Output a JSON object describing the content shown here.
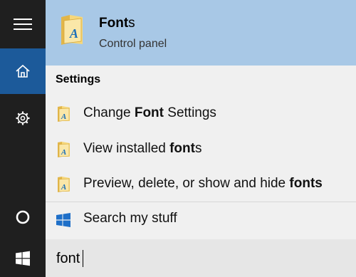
{
  "rail": {
    "icons": [
      "hamburger-icon",
      "home-icon",
      "gear-icon",
      "cortana-icon",
      "windows-icon"
    ]
  },
  "top_result": {
    "title_bold": "Font",
    "title_rest": "s",
    "subtitle": "Control panel"
  },
  "settings": {
    "heading": "Settings",
    "items": [
      {
        "pre": "Change ",
        "bold": "Font",
        "post": " Settings"
      },
      {
        "pre": "View installed ",
        "bold": "font",
        "post": "s"
      },
      {
        "pre": "Preview, delete, or show and hide ",
        "bold": "fonts",
        "post": ""
      }
    ]
  },
  "search_my_stuff": {
    "label": "Search my stuff"
  },
  "search": {
    "query": "font"
  },
  "colors": {
    "rail_bg": "#1f1f1f",
    "home_highlight": "#1c5a9a",
    "top_result_bg": "#a8c8e6",
    "panel_bg": "#f0f0f0"
  }
}
